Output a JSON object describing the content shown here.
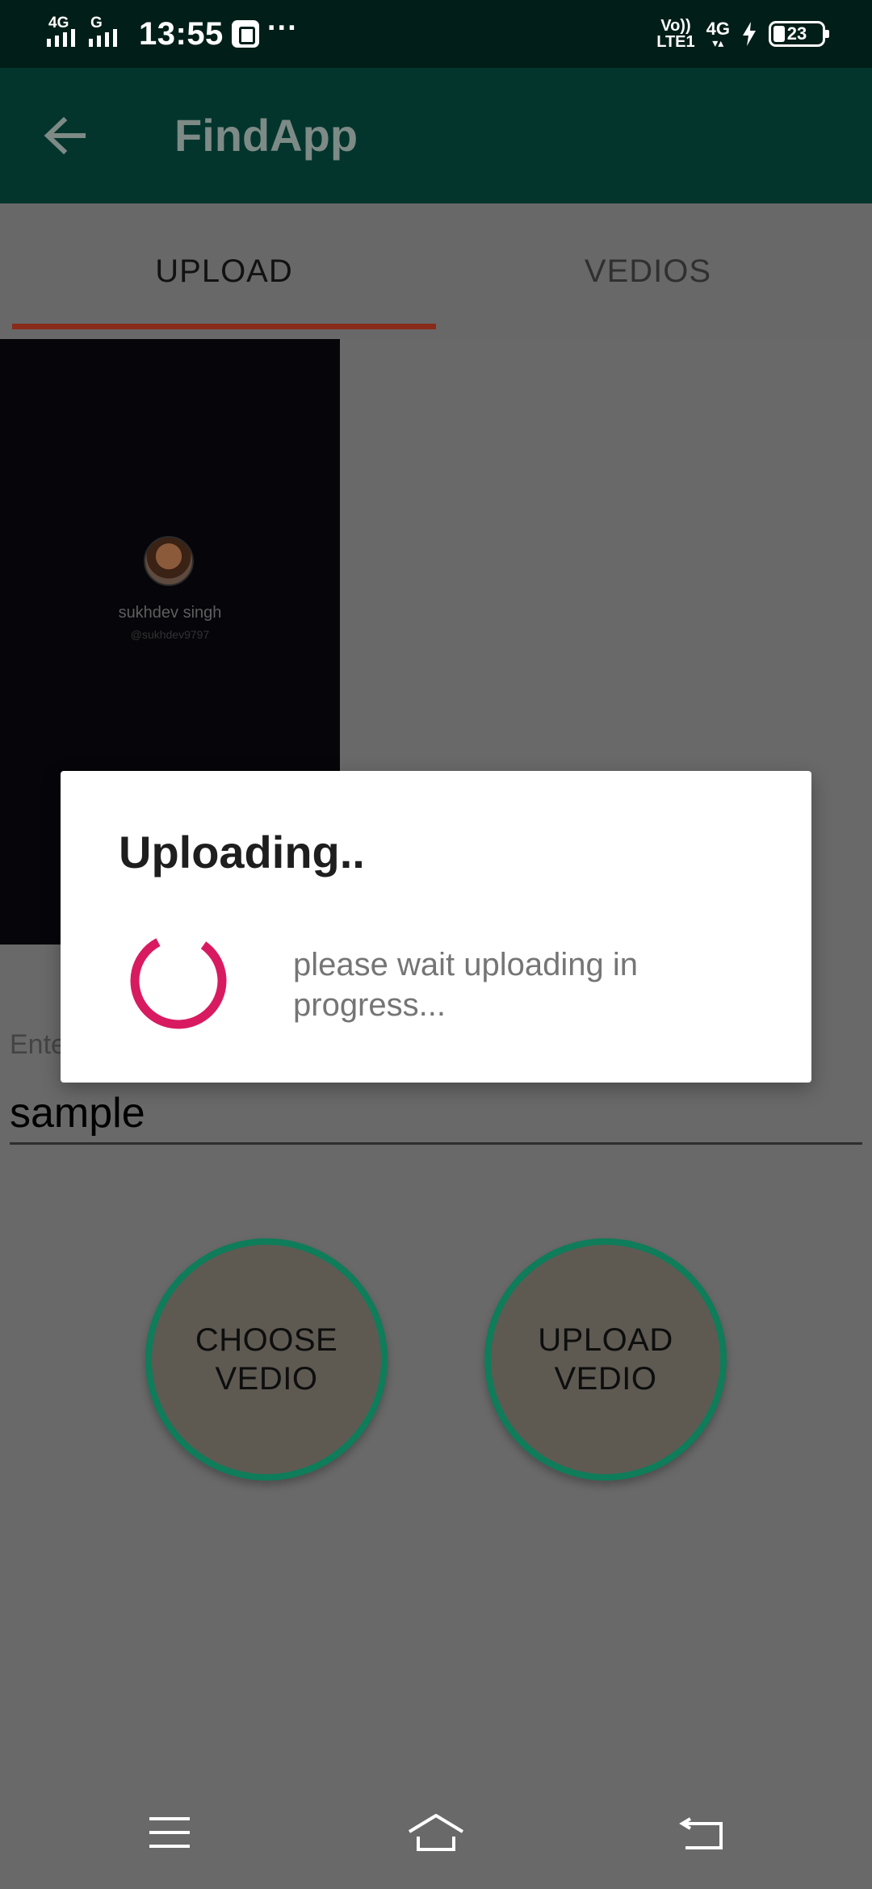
{
  "status_bar": {
    "network_1": "4G",
    "network_2": "G",
    "time": "13:55",
    "more": "···",
    "volte_top": "Vo))",
    "volte_bottom": "LTE1",
    "net_type": "4G",
    "battery_level": "23"
  },
  "toolbar": {
    "back_icon": "arrow-left-icon",
    "title": "FindApp"
  },
  "tabs": [
    {
      "label": "UPLOAD",
      "selected": true
    },
    {
      "label": "VEDIOS",
      "selected": false
    }
  ],
  "video_preview": {
    "name": "sukhdev singh",
    "handle": "@sukhdev9797"
  },
  "form": {
    "field_label": "Ente",
    "field_value": "sample"
  },
  "buttons": {
    "choose_line1": "CHOOSE",
    "choose_line2": "VEDIO",
    "upload_line1": "UPLOAD",
    "upload_line2": "VEDIO"
  },
  "dialog": {
    "title": "Uploading..",
    "message": "please wait uploading in progress..."
  },
  "nav_bar": {
    "icons": [
      "menu-icon",
      "home-icon",
      "back-icon"
    ]
  },
  "colors": {
    "status_bar_bg": "#021e18",
    "toolbar_bg": "#03352d",
    "tab_indicator": "#8a2a1a",
    "button_ring": "#0f7c5a",
    "spinner": "#d81b60",
    "scrim": "#696969"
  }
}
